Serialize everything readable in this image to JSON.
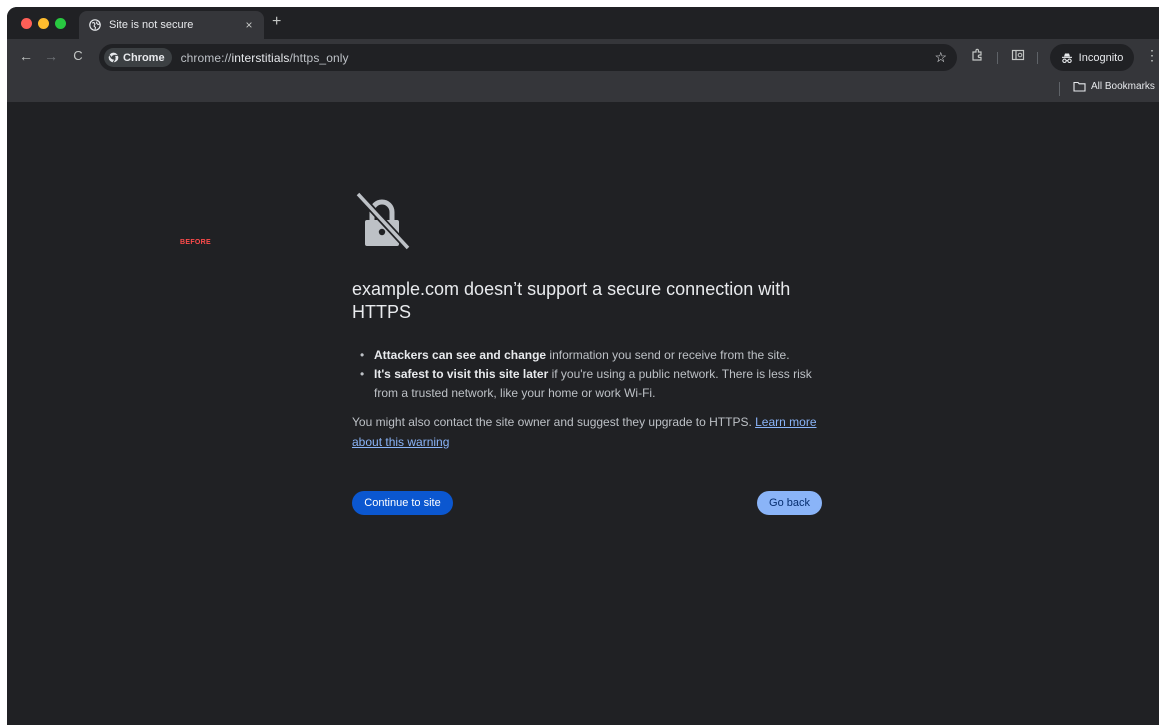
{
  "tab": {
    "title": "Site is not secure",
    "close_glyph": "×",
    "new_tab_glyph": "+"
  },
  "toolbar": {
    "back_glyph": "←",
    "forward_glyph": "→",
    "reload_glyph": "C",
    "chip_label": "Chrome",
    "url_scheme": "chrome://",
    "url_host": "interstitials",
    "url_path": "/https_only",
    "star_glyph": "☆",
    "incognito_label": "Incognito",
    "menu_glyph": "⋮"
  },
  "bookmarks": {
    "all_bookmarks_label": "All Bookmarks"
  },
  "overlay_label": "BEFORE",
  "interstitial": {
    "heading": "example.com doesn’t support a secure connection with HTTPS",
    "bullets": [
      {
        "bold": "Attackers can see and change",
        "text": " information you send or receive from the site."
      },
      {
        "bold": "It's safest to visit this site later",
        "text": " if you're using a public network. There is less risk from a trusted network, like your home or work Wi-Fi."
      }
    ],
    "paragraph_text": "You might also contact the site owner and suggest they upgrade to HTTPS. ",
    "learn_more_link": "Learn more about this warning",
    "continue_button": "Continue to site",
    "go_back_button": "Go back"
  },
  "colors": {
    "page_background": "#202124",
    "primary_button": "#0b57d0",
    "secondary_button": "#8ab4f8",
    "link": "#8ab4f8"
  },
  "icons": [
    "globe-icon",
    "chrome-logo-icon",
    "star-icon",
    "extensions-icon",
    "reading-list-icon",
    "incognito-icon",
    "folder-icon",
    "lock-slash-icon"
  ]
}
